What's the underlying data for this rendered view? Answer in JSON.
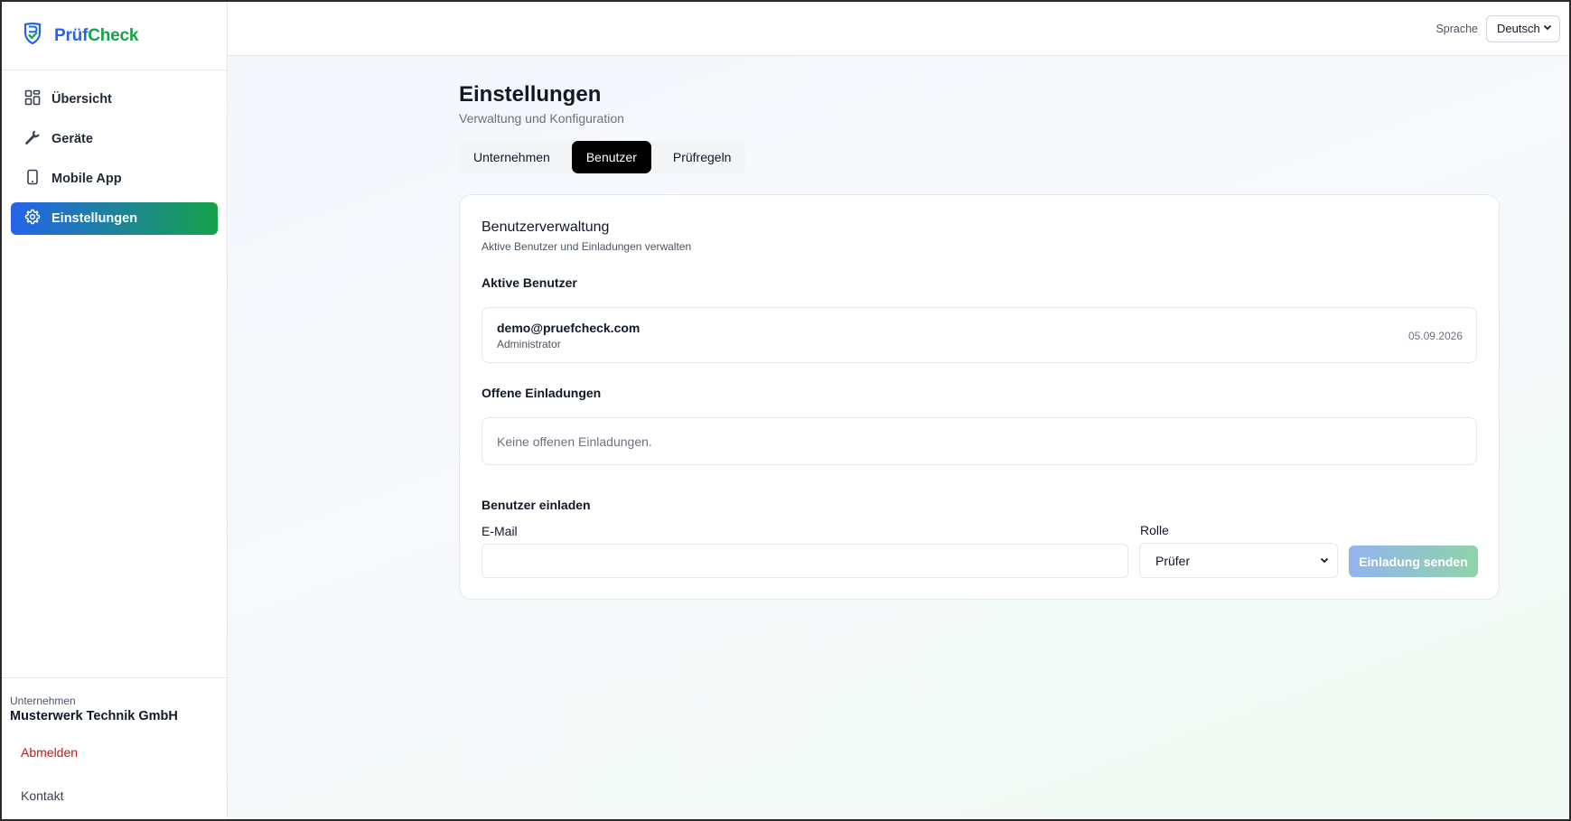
{
  "brand": {
    "name_part1": "Prüf",
    "name_part2": "Check",
    "icon": "shield-logo-icon"
  },
  "sidebar": {
    "items": [
      {
        "label": "Übersicht",
        "icon": "dashboard-icon",
        "active": false
      },
      {
        "label": "Geräte",
        "icon": "wrench-icon",
        "active": false
      },
      {
        "label": "Mobile App",
        "icon": "smartphone-icon",
        "active": false
      },
      {
        "label": "Einstellungen",
        "icon": "gear-icon",
        "active": true
      }
    ],
    "company_label": "Unternehmen",
    "company_name": "Musterwerk Technik GmbH",
    "logout": "Abmelden",
    "contact": "Kontakt"
  },
  "topbar": {
    "language_label": "Sprache",
    "language_value": "Deutsch"
  },
  "page": {
    "title": "Einstellungen",
    "subtitle": "Verwaltung und Konfiguration",
    "tabs": [
      {
        "label": "Unternehmen",
        "active": false
      },
      {
        "label": "Benutzer",
        "active": true
      },
      {
        "label": "Prüfregeln",
        "active": false
      }
    ]
  },
  "card": {
    "title": "Benutzerverwaltung",
    "subtitle": "Aktive Benutzer und Einladungen verwalten",
    "active_users_title": "Aktive Benutzer",
    "users": [
      {
        "email": "demo@pruefcheck.com",
        "role": "Administrator",
        "date": "05.09.2026"
      }
    ],
    "open_invites_title": "Offene Einladungen",
    "open_invites_empty": "Keine offenen Einladungen.",
    "invite_title": "Benutzer einladen",
    "email_label": "E-Mail",
    "email_value": "",
    "role_label": "Rolle",
    "role_value": "Prüfer",
    "send_button": "Einladung senden"
  },
  "colors": {
    "brand_blue": "#2563eb",
    "brand_green": "#16a34a",
    "logout_red": "#b91c1c",
    "active_tab": "#000000"
  }
}
